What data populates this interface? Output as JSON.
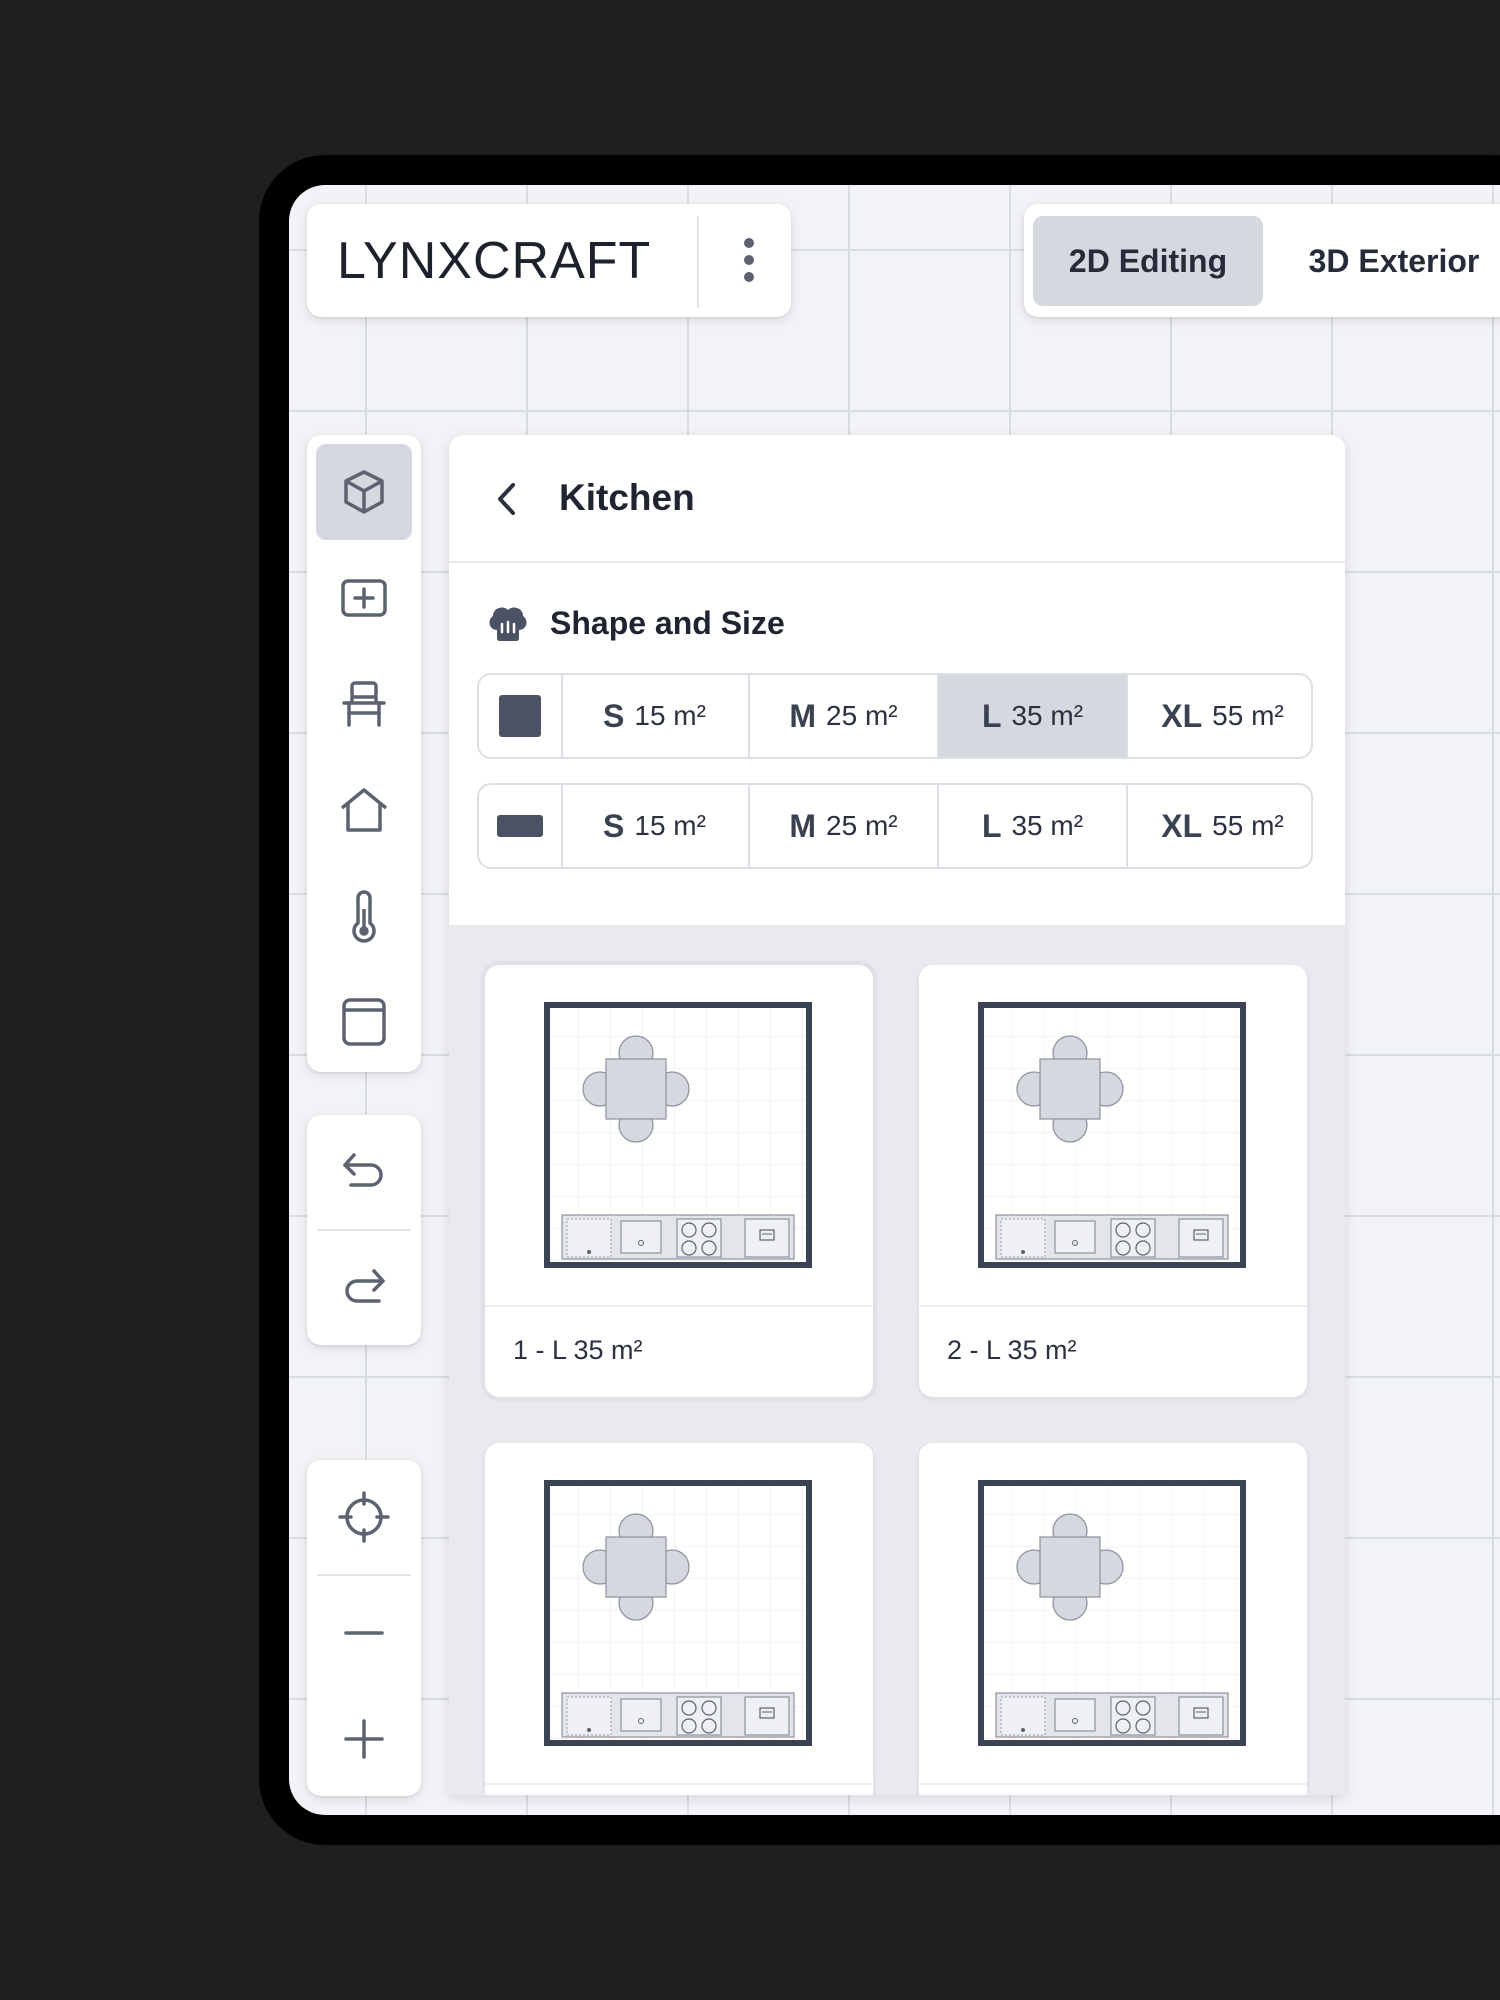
{
  "app": {
    "logo": "LYNXCRAFT"
  },
  "mode_tabs": [
    {
      "label": "2D Editing",
      "active": true
    },
    {
      "label": "3D Exterior",
      "active": false
    }
  ],
  "toolbar": {
    "tools": [
      "cube-icon",
      "add-box-icon",
      "chair-icon",
      "home-icon",
      "thermometer-icon",
      "window-icon"
    ],
    "history": [
      "undo-icon",
      "redo-icon"
    ],
    "zoom": [
      "crosshair-icon",
      "minus-icon",
      "plus-icon"
    ]
  },
  "panel": {
    "title": "Kitchen",
    "section_title": "Shape and Size",
    "square_row": [
      {
        "size": "S",
        "area": "15 m²",
        "active": false
      },
      {
        "size": "M",
        "area": "25 m²",
        "active": false
      },
      {
        "size": "L",
        "area": "35 m²",
        "active": true
      },
      {
        "size": "XL",
        "area": "55 m²",
        "active": false
      }
    ],
    "rect_row": [
      {
        "size": "S",
        "area": "15 m²",
        "active": false
      },
      {
        "size": "M",
        "area": "25 m²",
        "active": false
      },
      {
        "size": "L",
        "area": "35 m²",
        "active": false
      },
      {
        "size": "XL",
        "area": "55 m²",
        "active": false
      }
    ],
    "layouts": [
      {
        "label": "1 - L 35 m²",
        "selected": true
      },
      {
        "label": "2 - L 35 m²",
        "selected": false
      },
      {
        "label": "",
        "selected": false
      },
      {
        "label": "",
        "selected": false
      }
    ]
  },
  "colors": {
    "background": "#1f1f1f",
    "accent_active": "#d5d8df",
    "wall": "#3b4352",
    "text": "#1f2430"
  }
}
